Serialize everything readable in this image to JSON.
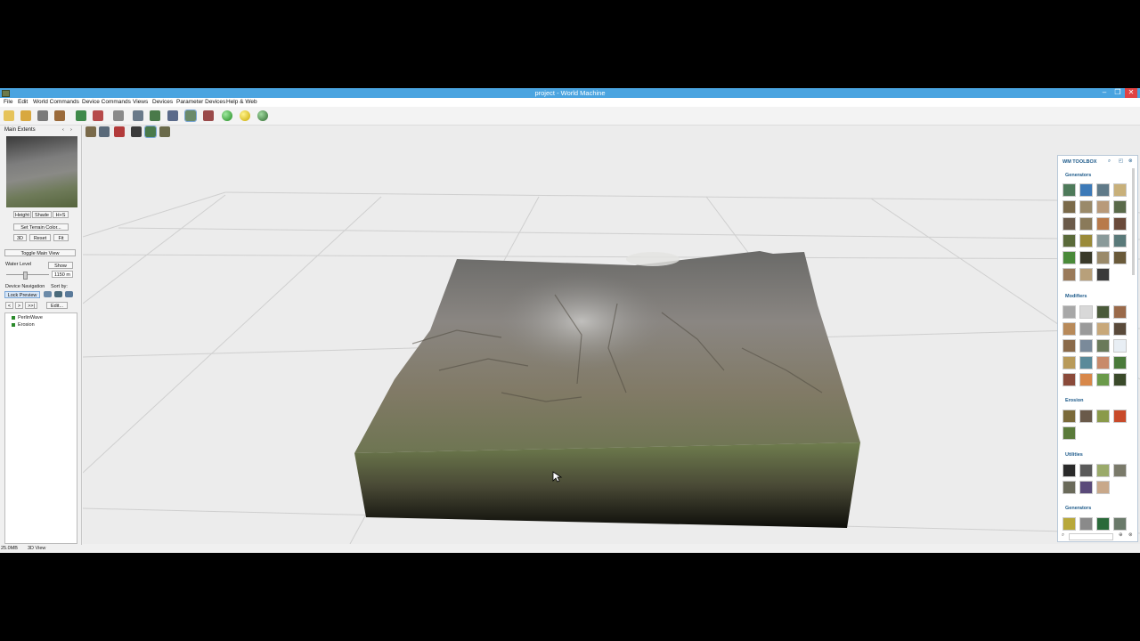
{
  "window": {
    "title": "project - World Machine",
    "controls": [
      "‒",
      "❐",
      "✕"
    ]
  },
  "menu": [
    "File",
    "Edit",
    "World Commands",
    "Device Commands",
    "Views",
    "Devices",
    "Parameter Devices",
    "Help & Web"
  ],
  "left_panel": {
    "header": "Main Extents",
    "view_buttons": [
      "Height",
      "Shade",
      "H+S"
    ],
    "set_color": "Set Terrain Color...",
    "nav_buttons": [
      "3D",
      "Reset",
      "Fit"
    ],
    "toggle_main": "Toggle Main View",
    "water_level_label": "Water Level",
    "water_show": "Show",
    "water_value": "1150 m",
    "device_nav_label": "Device Navigation",
    "sort_by_label": "Sort by:",
    "lock_preview": "Lock Preview",
    "back": "<",
    "forward": ">",
    "forward_all": ">>|",
    "edit": "Edit..."
  },
  "tree": {
    "items": [
      "PerlinWave",
      "Erosion"
    ]
  },
  "toolbox": {
    "title": "WM TOOLBOX",
    "sections": [
      "Generators",
      "Modifiers",
      "Erosion",
      "Utilities",
      "Generators"
    ]
  },
  "statusbar": {
    "memory": "25.0MB",
    "view": "3D View"
  },
  "colors": {
    "titlebar": "#4aa4e0",
    "accent": "#1d5a8a"
  }
}
